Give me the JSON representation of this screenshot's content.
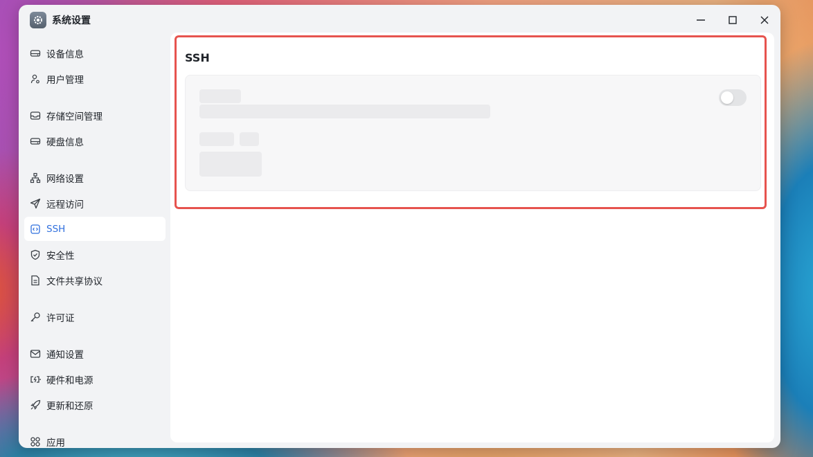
{
  "window": {
    "title": "系统设置"
  },
  "sidebar": {
    "items": [
      {
        "label": "设备信息",
        "icon": "hard-drive-icon"
      },
      {
        "label": "用户管理",
        "icon": "user-settings-icon"
      },
      {
        "label": "存储空间管理",
        "icon": "inbox-storage-icon"
      },
      {
        "label": "硬盘信息",
        "icon": "hard-disk-icon"
      },
      {
        "label": "网络设置",
        "icon": "network-icon"
      },
      {
        "label": "远程访问",
        "icon": "send-icon"
      },
      {
        "label": "SSH",
        "icon": "code-icon",
        "active": true
      },
      {
        "label": "安全性",
        "icon": "shield-icon"
      },
      {
        "label": "文件共享协议",
        "icon": "file-icon"
      },
      {
        "label": "许可证",
        "icon": "key-icon"
      },
      {
        "label": "通知设置",
        "icon": "mail-icon"
      },
      {
        "label": "硬件和电源",
        "icon": "battery-charging-icon"
      },
      {
        "label": "更新和还原",
        "icon": "rocket-icon"
      },
      {
        "label": "应用",
        "icon": "grid-apps-icon"
      }
    ]
  },
  "main": {
    "section_title": "SSH",
    "ssh_toggle_enabled": false
  },
  "colors": {
    "accent": "#2f6fde",
    "highlight_border": "#e6534e",
    "window_bg": "#f2f3f5",
    "content_bg": "#ffffff"
  }
}
